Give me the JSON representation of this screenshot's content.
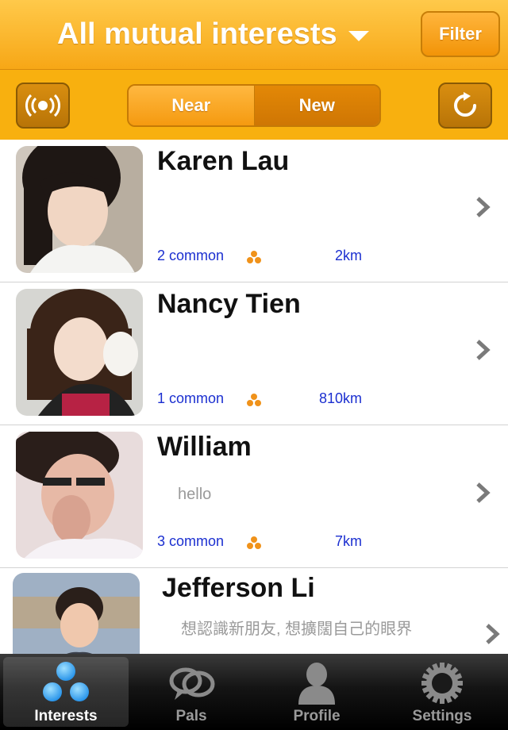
{
  "header": {
    "title": "All mutual interests",
    "filter_label": "Filter"
  },
  "toolbar": {
    "segments": [
      "Near",
      "New"
    ],
    "selected_segment": "New"
  },
  "people": [
    {
      "name": "Karen Lau",
      "status": "",
      "common": "2 common",
      "distance": "2km"
    },
    {
      "name": "Nancy Tien",
      "status": "",
      "common": "1 common",
      "distance": "810km"
    },
    {
      "name": "William",
      "status": "hello",
      "common": "3 common",
      "distance": "7km"
    },
    {
      "name": "Jefferson Li",
      "status": "想認識新朋友, 想擴闊自己的眼界",
      "common": "",
      "distance": ""
    }
  ],
  "tabs": [
    {
      "label": "Interests",
      "icon": "interests-icon",
      "active": true
    },
    {
      "label": "Pals",
      "icon": "pals-icon",
      "active": false
    },
    {
      "label": "Profile",
      "icon": "profile-icon",
      "active": false
    },
    {
      "label": "Settings",
      "icon": "settings-icon",
      "active": false
    }
  ],
  "colors": {
    "accent": "#f8b00f",
    "link": "#1b2fd0",
    "dots": "#f0921a"
  }
}
